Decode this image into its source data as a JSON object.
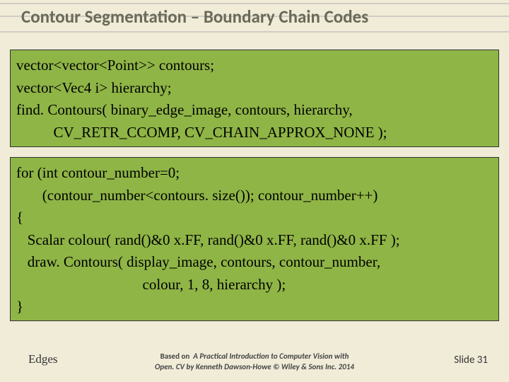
{
  "title": "Contour Segmentation – Boundary Chain Codes",
  "code_top": [
    "vector<vector<Point>> contours;",
    "vector<Vec4 i> hierarchy;",
    "find. Contours( binary_edge_image, contours, hierarchy,",
    "          CV_RETR_CCOMP, CV_CHAIN_APPROX_NONE );"
  ],
  "code_bottom": [
    "for (int contour_number=0;",
    "       (contour_number<contours. size()); contour_number++)",
    "{",
    "   Scalar colour( rand()&0 x.FF, rand()&0 x.FF, rand()&0 x.FF );",
    "   draw. Contours( display_image, contours, contour_number,",
    "                                  colour, 1, 8, hierarchy );",
    "}"
  ],
  "footer": {
    "left": "Edges",
    "center_line1": "Based on",
    "center_italic": "A Practical Introduction to Computer Vision with",
    "center_line2": "Open. CV  by Kenneth Dawson-Howe © Wiley & Sons Inc. 2014",
    "right": "Slide 31"
  }
}
